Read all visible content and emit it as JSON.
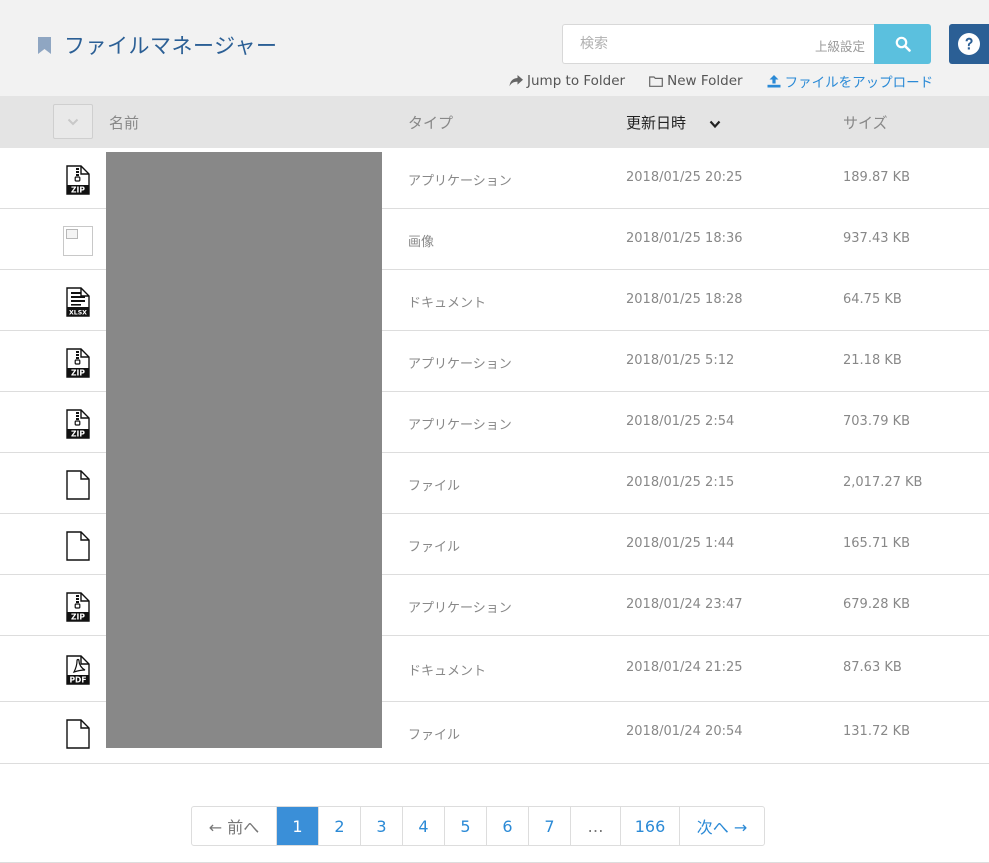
{
  "header": {
    "title": "ファイルマネージャー",
    "search_placeholder": "検索",
    "advanced_label": "上級設定",
    "jump_label": "Jump to Folder",
    "new_folder_label": "New Folder",
    "upload_label": "ファイルをアップロード"
  },
  "columns": {
    "name": "名前",
    "type": "タイプ",
    "date": "更新日時",
    "size": "サイズ"
  },
  "rows": [
    {
      "icon": "zip-file-icon",
      "type": "アプリケーション",
      "date": "2018/01/25 20:25",
      "size": "189.87 KB"
    },
    {
      "icon": "broken-image-icon",
      "type": "画像",
      "date": "2018/01/25 18:36",
      "size": "937.43 KB"
    },
    {
      "icon": "xlsx-file-icon",
      "type": "ドキュメント",
      "date": "2018/01/25 18:28",
      "size": "64.75 KB"
    },
    {
      "icon": "zip-file-icon",
      "type": "アプリケーション",
      "date": "2018/01/25 5:12",
      "size": "21.18 KB"
    },
    {
      "icon": "zip-file-icon",
      "type": "アプリケーション",
      "date": "2018/01/25 2:54",
      "size": "703.79 KB"
    },
    {
      "icon": "generic-file-icon",
      "type": "ファイル",
      "date": "2018/01/25 2:15",
      "size": "2,017.27 KB"
    },
    {
      "icon": "generic-file-icon",
      "type": "ファイル",
      "date": "2018/01/25 1:44",
      "size": "165.71 KB"
    },
    {
      "icon": "zip-file-icon",
      "type": "アプリケーション",
      "date": "2018/01/24 23:47",
      "size": "679.28 KB"
    },
    {
      "icon": "pdf-file-icon",
      "type": "ドキュメント",
      "date": "2018/01/24 21:25",
      "size": "87.63 KB"
    },
    {
      "icon": "generic-file-icon",
      "type": "ファイル",
      "date": "2018/01/24 20:54",
      "size": "131.72 KB"
    }
  ],
  "icon_labels": {
    "zip": "ZIP",
    "xlsx": "XLSX",
    "pdf": "PDF"
  },
  "pagination": {
    "prev": "← 前へ",
    "pages": [
      "1",
      "2",
      "3",
      "4",
      "5",
      "6",
      "7"
    ],
    "ellipsis": "…",
    "last": "166",
    "next": "次へ →",
    "current": "1"
  },
  "colors": {
    "accent": "#2b5f95",
    "search_button": "#5bc0de",
    "active_page": "#3a8fd8",
    "redacted": "#888888"
  }
}
